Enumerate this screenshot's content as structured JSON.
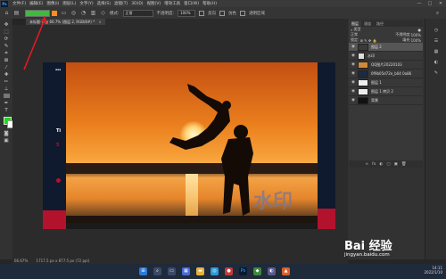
{
  "menubar": {
    "logo": "Ps",
    "items": [
      "文件(F)",
      "编辑(E)",
      "图像(I)",
      "图层(L)",
      "文字(Y)",
      "选择(S)",
      "滤镜(T)",
      "3D(D)",
      "视图(V)",
      "增效工具",
      "窗口(W)",
      "帮助(H)"
    ],
    "min": "—",
    "max": "□",
    "close": "✕"
  },
  "optbar": {
    "mode_label": "模式:",
    "mode_value": "正常",
    "opacity_label": "不透明度:",
    "opacity_value": "100%",
    "reverse_label": "反向",
    "dither_label": "仿色",
    "transparency_label": "透明区域"
  },
  "document": {
    "tab_label": "未标题-1 @ 66.7% (图层 2, RGB/8#) *",
    "close": "×",
    "watermark_text": "水印",
    "side_text_1": "Ti",
    "side_text_2": "5"
  },
  "layers_panel": {
    "tabs": [
      "图层",
      "通道",
      "路径"
    ],
    "filter_label": "类型",
    "blend_mode": "正常",
    "opacity_label": "不透明度:",
    "opacity_value": "100%",
    "lock_label": "锁定:",
    "fill_label": "填充:",
    "fill_value": "100%",
    "layers": [
      {
        "name": "图层 2",
        "active": true
      },
      {
        "name": "水印",
        "active": false
      },
      {
        "name": "QQ图片20220103",
        "active": false
      },
      {
        "name": "0f9b05d72e_b04 0a86",
        "active": false
      },
      {
        "name": "图层 1",
        "active": false
      },
      {
        "name": "图层 1 拷贝 2",
        "active": false
      },
      {
        "name": "背景",
        "active": false
      }
    ],
    "footer_icons": [
      "∞",
      "fx",
      "◐",
      "▢",
      "▣",
      "🗑"
    ]
  },
  "statusbar": {
    "zoom": "66.67%",
    "doc_size": "1717.5 px x 877.5 px (72 ppi)"
  },
  "taskbar": {
    "time": "14:11",
    "date": "2022/1/10"
  },
  "watermark_site": {
    "brand": "Bai 经验",
    "url": "jingyan.baidu.com"
  },
  "colors": {
    "foreground": "#1fd61f",
    "background": "#ffffff",
    "accent_annotation": "#e11b22"
  }
}
